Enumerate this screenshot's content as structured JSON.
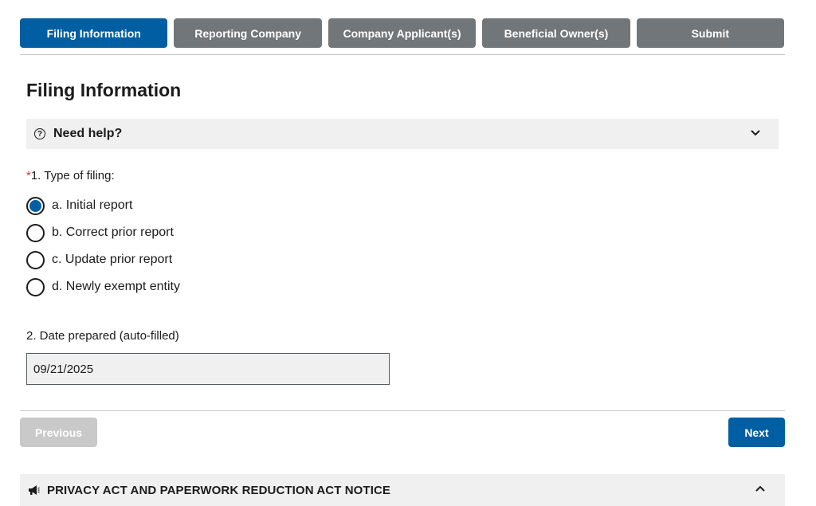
{
  "tabs": [
    {
      "label": "Filing Information",
      "active": true
    },
    {
      "label": "Reporting Company",
      "active": false
    },
    {
      "label": "Company Applicant(s)",
      "active": false
    },
    {
      "label": "Beneficial Owner(s)",
      "active": false
    },
    {
      "label": "Submit",
      "active": false
    }
  ],
  "page_title": "Filing Information",
  "help": {
    "label": "Need help?",
    "icon": "question-circle-icon",
    "chevron": "chevron-down-icon"
  },
  "question1": {
    "required_marker": "*",
    "label": "1. Type of filing:",
    "options": [
      {
        "label": "a. Initial report",
        "checked": true
      },
      {
        "label": "b. Correct prior report",
        "checked": false
      },
      {
        "label": "c. Update prior report",
        "checked": false
      },
      {
        "label": "d. Newly exempt entity",
        "checked": false
      }
    ]
  },
  "question2": {
    "label": "2. Date prepared (auto-filled)",
    "value": "09/21/2025"
  },
  "buttons": {
    "previous": "Previous",
    "next": "Next"
  },
  "notice": {
    "label": "PRIVACY ACT AND PAPERWORK REDUCTION ACT NOTICE",
    "icon": "megaphone-icon",
    "chevron": "chevron-up-icon"
  },
  "colors": {
    "primary": "#005ea2",
    "tab_inactive": "#71767a",
    "disabled": "#c9c9c9",
    "panel_bg": "#f0f0f0",
    "required": "#d83933"
  }
}
